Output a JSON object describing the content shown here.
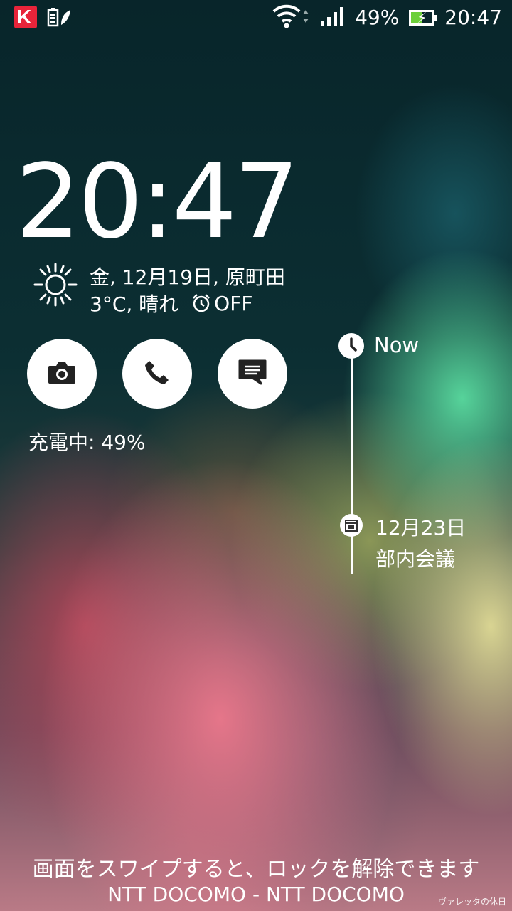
{
  "status_bar": {
    "battery_percent": "49%",
    "time": "20:47",
    "battery_level": 0.49,
    "icons_left": [
      "kaspersky-icon",
      "eco-battery-icon"
    ],
    "icons_right": [
      "wifi-icon",
      "signal-icon",
      "battery-charging-icon"
    ]
  },
  "lockscreen": {
    "clock": "20:47",
    "weather": {
      "line1": "金, 12月19日, 原町田",
      "temp_condition": "3°C, 晴れ",
      "alarm": "OFF"
    },
    "charging": "充電中: 49%",
    "shortcuts": [
      {
        "icon": "camera-icon"
      },
      {
        "icon": "phone-icon"
      },
      {
        "icon": "message-icon"
      }
    ],
    "timeline": {
      "now_label": "Now",
      "event_date": "12月23日",
      "event_title": "部内会議"
    },
    "unlock_hint": "画面をスワイプすると、ロックを解除できます",
    "carrier": "NTT DOCOMO - NTT DOCOMO",
    "watermark": "ヴァレッタの休日"
  },
  "colors": {
    "battery_fill": "#6ccf3b",
    "kaspersky_red": "#e8243a"
  }
}
